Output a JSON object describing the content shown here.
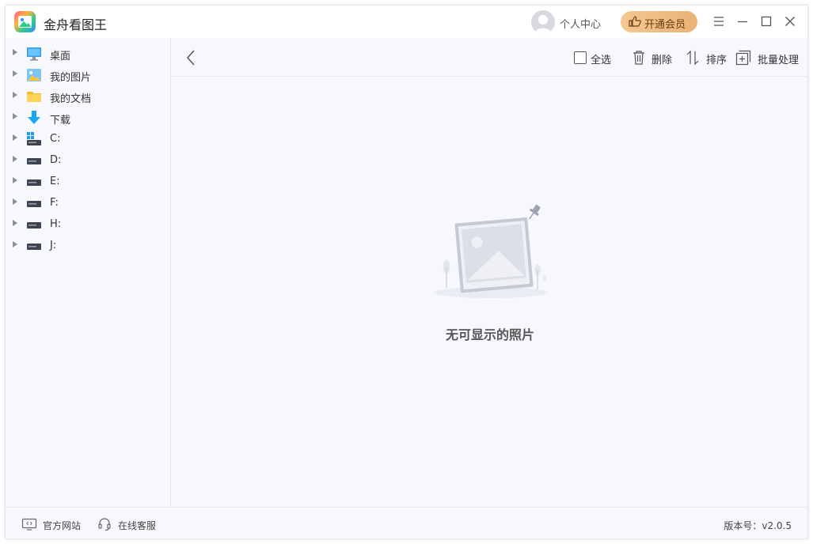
{
  "app": {
    "title": "金舟看图王"
  },
  "header": {
    "user_label": "个人中心",
    "vip_button": "开通会员",
    "controls": [
      "menu-icon",
      "minimize-icon",
      "maximize-icon",
      "close-icon"
    ]
  },
  "sidebar": {
    "items": [
      {
        "label": "桌面",
        "icon": "desktop-icon"
      },
      {
        "label": "我的图片",
        "icon": "pictures-folder-icon"
      },
      {
        "label": "我的文档",
        "icon": "documents-folder-icon"
      },
      {
        "label": "下载",
        "icon": "download-icon"
      },
      {
        "label": "C:",
        "icon": "system-drive-icon"
      },
      {
        "label": "D:",
        "icon": "drive-icon"
      },
      {
        "label": "E:",
        "icon": "drive-icon"
      },
      {
        "label": "F:",
        "icon": "drive-icon"
      },
      {
        "label": "H:",
        "icon": "drive-icon"
      },
      {
        "label": "J:",
        "icon": "drive-icon"
      }
    ]
  },
  "toolbar": {
    "select_all": "全选",
    "delete": "删除",
    "sort": "排序",
    "batch": "批量处理"
  },
  "main": {
    "empty_text": "无可显示的照片"
  },
  "footer": {
    "website": "官方网站",
    "support": "在线客服",
    "version": "版本号：v2.0.5"
  },
  "colors": {
    "accent_vip": "#eebb80",
    "sidebar_bg": "#f6f8fb",
    "main_bg": "#f6f8fd"
  }
}
